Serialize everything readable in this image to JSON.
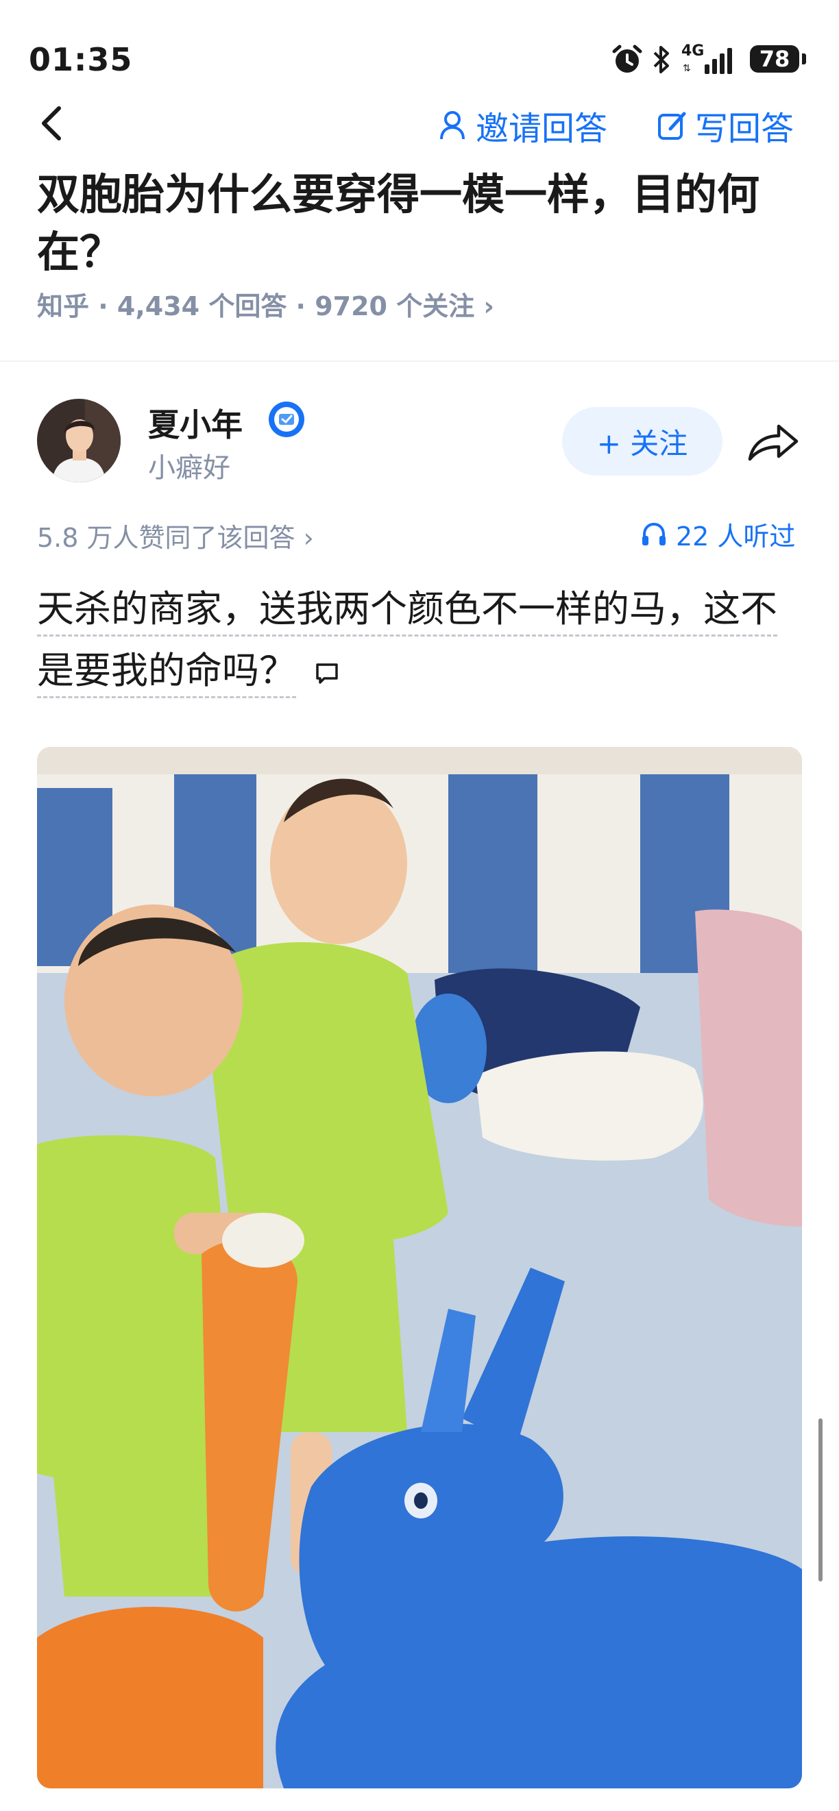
{
  "status_bar": {
    "time": "01:35",
    "network": "4G",
    "battery": "78"
  },
  "nav": {
    "invite_label": "邀请回答",
    "write_label": "写回答"
  },
  "question": {
    "title": "双胞胎为什么要穿得一模一样，目的何在？",
    "meta": "知乎 · 4,434 个回答 · 9720 个关注 ›"
  },
  "author": {
    "name": "夏小年",
    "subtitle": "小癖好",
    "follow_label": "+ 关注"
  },
  "answer": {
    "votes": "5.8 万人赞同了该回答 ›",
    "listeners": "22 人听过",
    "text": "天杀的商家，送我两个颜色不一样的马，这不是要我的命吗？"
  },
  "colors": {
    "accent": "#1772f6",
    "meta_gray": "#8590a6",
    "follow_bg": "#ebf3ff"
  }
}
